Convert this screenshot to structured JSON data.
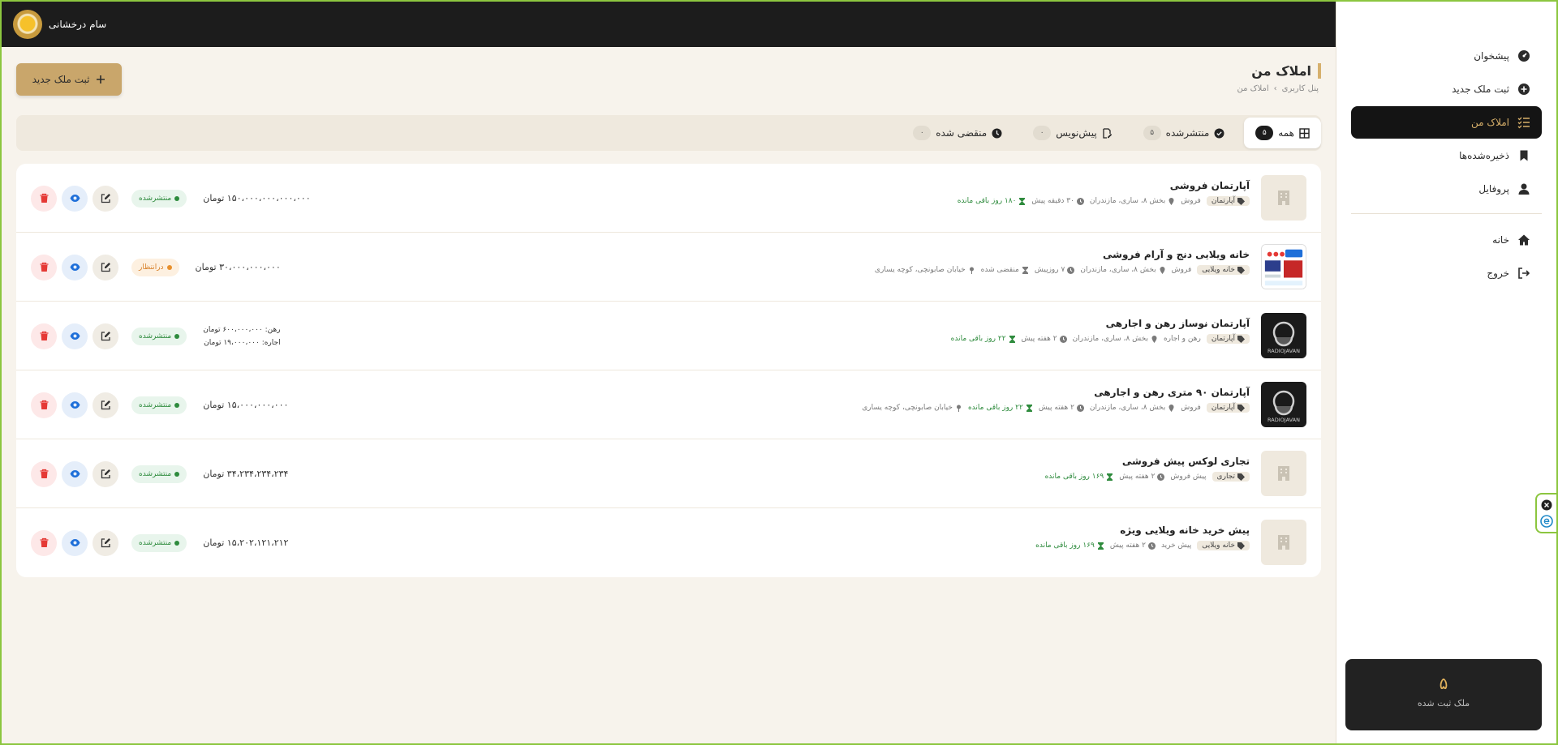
{
  "user": {
    "name": "سام درخشانی"
  },
  "sidebar": {
    "items": [
      {
        "label": "پیشخوان",
        "icon": "dashboard-icon"
      },
      {
        "label": "ثبت ملک جدید",
        "icon": "plus-circle-icon"
      },
      {
        "label": "املاک من",
        "icon": "list-check-icon",
        "active": true
      },
      {
        "label": "ذخیره‌شده‌ها",
        "icon": "bookmark-icon"
      },
      {
        "label": "پروفایل",
        "icon": "user-icon"
      }
    ],
    "secondary": [
      {
        "label": "خانه",
        "icon": "home-icon"
      },
      {
        "label": "خروج",
        "icon": "logout-icon"
      }
    ],
    "stat": {
      "value": "۵",
      "label": "ملک ثبت شده"
    }
  },
  "page": {
    "title": "املاک من",
    "breadcrumb": [
      "پنل کاربری",
      "›",
      "املاک من"
    ],
    "add_button": "ثبت ملک جدید"
  },
  "tabs": [
    {
      "label": "همه",
      "count": "۵",
      "icon": "grid-icon",
      "active": true
    },
    {
      "label": "منتشرشده",
      "count": "۵",
      "icon": "check-circle-icon"
    },
    {
      "label": "پیش‌نویس",
      "count": "۰",
      "icon": "edit-file-icon"
    },
    {
      "label": "منقضی شده",
      "count": "۰",
      "icon": "clock-icon"
    }
  ],
  "listings": [
    {
      "title": "آپارتمان فروشی",
      "type": "آپارتمان",
      "deal": "فروش",
      "location": "بخش ۸، ساری، مازندران",
      "time": "۳۰ دقیقه پیش",
      "remaining": "۱۸۰ روز باقی مانده",
      "price": "۱۵۰،۰۰۰،۰۰۰،۰۰۰،۰۰۰ تومان",
      "status": "منتشرشده"
    },
    {
      "title": "خانه ویلایی دنج و آرام فروشی",
      "type": "خانه ویلایی",
      "deal": "فروش",
      "location": "بخش ۸، ساری، مازندران",
      "time": "۷ روزپیش",
      "remaining": "منقضی شده",
      "address": "خیابان صابونچی، کوچه یساری",
      "price": "۳۰،۰۰۰،۰۰۰،۰۰۰ تومان",
      "status": "درانتظار"
    },
    {
      "title": "آپارتمان نوساز رهن و اجارهی",
      "type": "آپارتمان",
      "deal": "رهن و اجاره",
      "location": "بخش ۸، ساری، مازندران",
      "time": "۲ هفته پیش",
      "remaining": "۲۲ روز باقی مانده",
      "rent_deposit": "رهن: ۶۰۰،۰۰۰،۰۰۰ تومان",
      "rent_monthly": "اجاره: ۱۹،۰۰۰،۰۰۰ تومان",
      "status": "منتشرشده",
      "thumb_text": "RADIOJAVAN"
    },
    {
      "title": "آپارتمان ۹۰ متری رهن و اجارهی",
      "type": "آپارتمان",
      "deal": "فروش",
      "location": "بخش ۸، ساری، مازندران",
      "time": "۲ هفته پیش",
      "remaining": "۲۲ روز باقی مانده",
      "address": "خیابان صابونچی، کوچه یساری",
      "price": "۱۵،۰۰۰،۰۰۰،۰۰۰ تومان",
      "status": "منتشرشده",
      "thumb_text": "RADIOJAVAN"
    },
    {
      "title": "تجاری لوکس پیش فروشی",
      "type": "تجاری",
      "deal": "پیش فروش",
      "time": "۲ هفته پیش",
      "remaining": "۱۶۹ روز باقی مانده",
      "price": "۳۴،۲۳۴،۲۳۴،۲۳۴ تومان",
      "status": "منتشرشده"
    },
    {
      "title": "پیش خرید خانه ویلایی ویژه",
      "type": "خانه ویلایی",
      "deal": "پیش خرید",
      "time": "۲ هفته پیش",
      "remaining": "۱۶۹ روز باقی مانده",
      "price": "۱۵،۲۰۲،۱۲۱،۲۱۲ تومان",
      "status": "منتشرشده"
    }
  ],
  "colors": {
    "accent": "#c9a66b",
    "dark": "#1c1c1c",
    "published": "#2e8b3d",
    "pending": "#e8902c",
    "delete": "#e53935",
    "view": "#1e6fd9"
  }
}
